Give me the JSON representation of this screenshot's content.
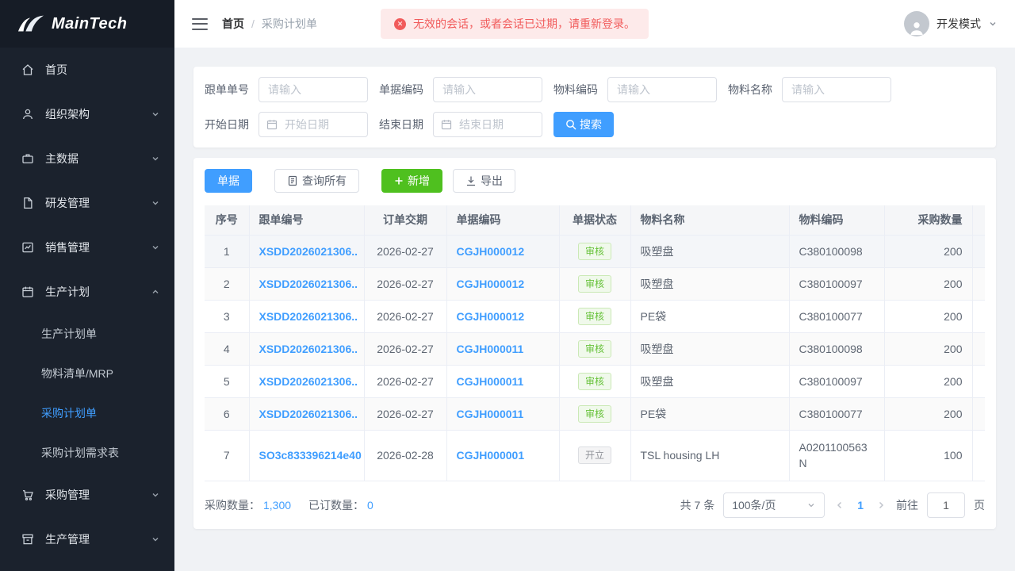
{
  "colors": {
    "primary": "#409eff",
    "success_button": "#4fc01f",
    "danger": "#f15b5b",
    "sidebar_bg": "#1b222d",
    "tag_success_text": "#67c23a",
    "tag_info_text": "#909399",
    "link": "#409eff"
  },
  "brand": {
    "name": "MainTech"
  },
  "sidebar": {
    "items": [
      {
        "label": "首页",
        "icon": "home-icon"
      },
      {
        "label": "组织架构",
        "icon": "user-icon"
      },
      {
        "label": "主数据",
        "icon": "briefcase-icon"
      },
      {
        "label": "研发管理",
        "icon": "document-icon"
      },
      {
        "label": "销售管理",
        "icon": "chart-icon"
      },
      {
        "label": "生产计划",
        "icon": "calendar-icon",
        "expanded": true,
        "children": [
          {
            "label": "生产计划单",
            "active": false
          },
          {
            "label": "物料清单/MRP",
            "active": false
          },
          {
            "label": "采购计划单",
            "active": true
          },
          {
            "label": "采购计划需求表",
            "active": false
          }
        ]
      },
      {
        "label": "采购管理",
        "icon": "cart-icon"
      },
      {
        "label": "生产管理",
        "icon": "box-icon"
      }
    ]
  },
  "header": {
    "breadcrumb": [
      "首页",
      "采购计划单"
    ],
    "alert": "无效的会话，或者会话已过期，请重新登录。",
    "user_mode": "开发模式"
  },
  "filters": {
    "fields": [
      {
        "label": "跟单单号",
        "placeholder": "请输入"
      },
      {
        "label": "单据编码",
        "placeholder": "请输入"
      },
      {
        "label": "物料编码",
        "placeholder": "请输入"
      },
      {
        "label": "物料名称",
        "placeholder": "请输入"
      }
    ],
    "date_fields": [
      {
        "label": "开始日期",
        "placeholder": "开始日期"
      },
      {
        "label": "结束日期",
        "placeholder": "结束日期"
      }
    ],
    "search_label": "搜索"
  },
  "toolbar": {
    "doc_button": "单据",
    "query_all_button": "查询所有",
    "add_button": "新增",
    "export_button": "导出"
  },
  "table": {
    "columns": [
      "序号",
      "跟单编号",
      "订单交期",
      "单据编码",
      "单据状态",
      "物料名称",
      "物料编码",
      "采购数量"
    ],
    "rows": [
      {
        "index": "1",
        "order_no": "XSDD2026021306..",
        "delivery_date": "2026-02-27",
        "doc_no": "CGJH000012",
        "status": "审核",
        "status_type": "success",
        "material_name": "吸塑盘",
        "material_code": "C380100098",
        "qty": "200"
      },
      {
        "index": "2",
        "order_no": "XSDD2026021306..",
        "delivery_date": "2026-02-27",
        "doc_no": "CGJH000012",
        "status": "审核",
        "status_type": "success",
        "material_name": "吸塑盘",
        "material_code": "C380100097",
        "qty": "200"
      },
      {
        "index": "3",
        "order_no": "XSDD2026021306..",
        "delivery_date": "2026-02-27",
        "doc_no": "CGJH000012",
        "status": "审核",
        "status_type": "success",
        "material_name": "PE袋",
        "material_code": "C380100077",
        "qty": "200"
      },
      {
        "index": "4",
        "order_no": "XSDD2026021306..",
        "delivery_date": "2026-02-27",
        "doc_no": "CGJH000011",
        "status": "审核",
        "status_type": "success",
        "material_name": "吸塑盘",
        "material_code": "C380100098",
        "qty": "200"
      },
      {
        "index": "5",
        "order_no": "XSDD2026021306..",
        "delivery_date": "2026-02-27",
        "doc_no": "CGJH000011",
        "status": "审核",
        "status_type": "success",
        "material_name": "吸塑盘",
        "material_code": "C380100097",
        "qty": "200"
      },
      {
        "index": "6",
        "order_no": "XSDD2026021306..",
        "delivery_date": "2026-02-27",
        "doc_no": "CGJH000011",
        "status": "审核",
        "status_type": "success",
        "material_name": "PE袋",
        "material_code": "C380100077",
        "qty": "200"
      },
      {
        "index": "7",
        "order_no": "SO3c833396214e40",
        "delivery_date": "2026-02-28",
        "doc_no": "CGJH000001",
        "status": "开立",
        "status_type": "info",
        "material_name": "TSL housing LH",
        "material_code": "A0201100563N",
        "qty": "100"
      }
    ]
  },
  "summary": {
    "purchase_qty_label": "采购数量：",
    "purchase_qty": "1,300",
    "ordered_qty_label": "已订数量：",
    "ordered_qty": "0"
  },
  "pagination": {
    "total": "共 7 条",
    "page_size": "100条/页",
    "current_page": "1",
    "goto_label": "前往",
    "goto_value": "1",
    "page_unit": "页"
  }
}
